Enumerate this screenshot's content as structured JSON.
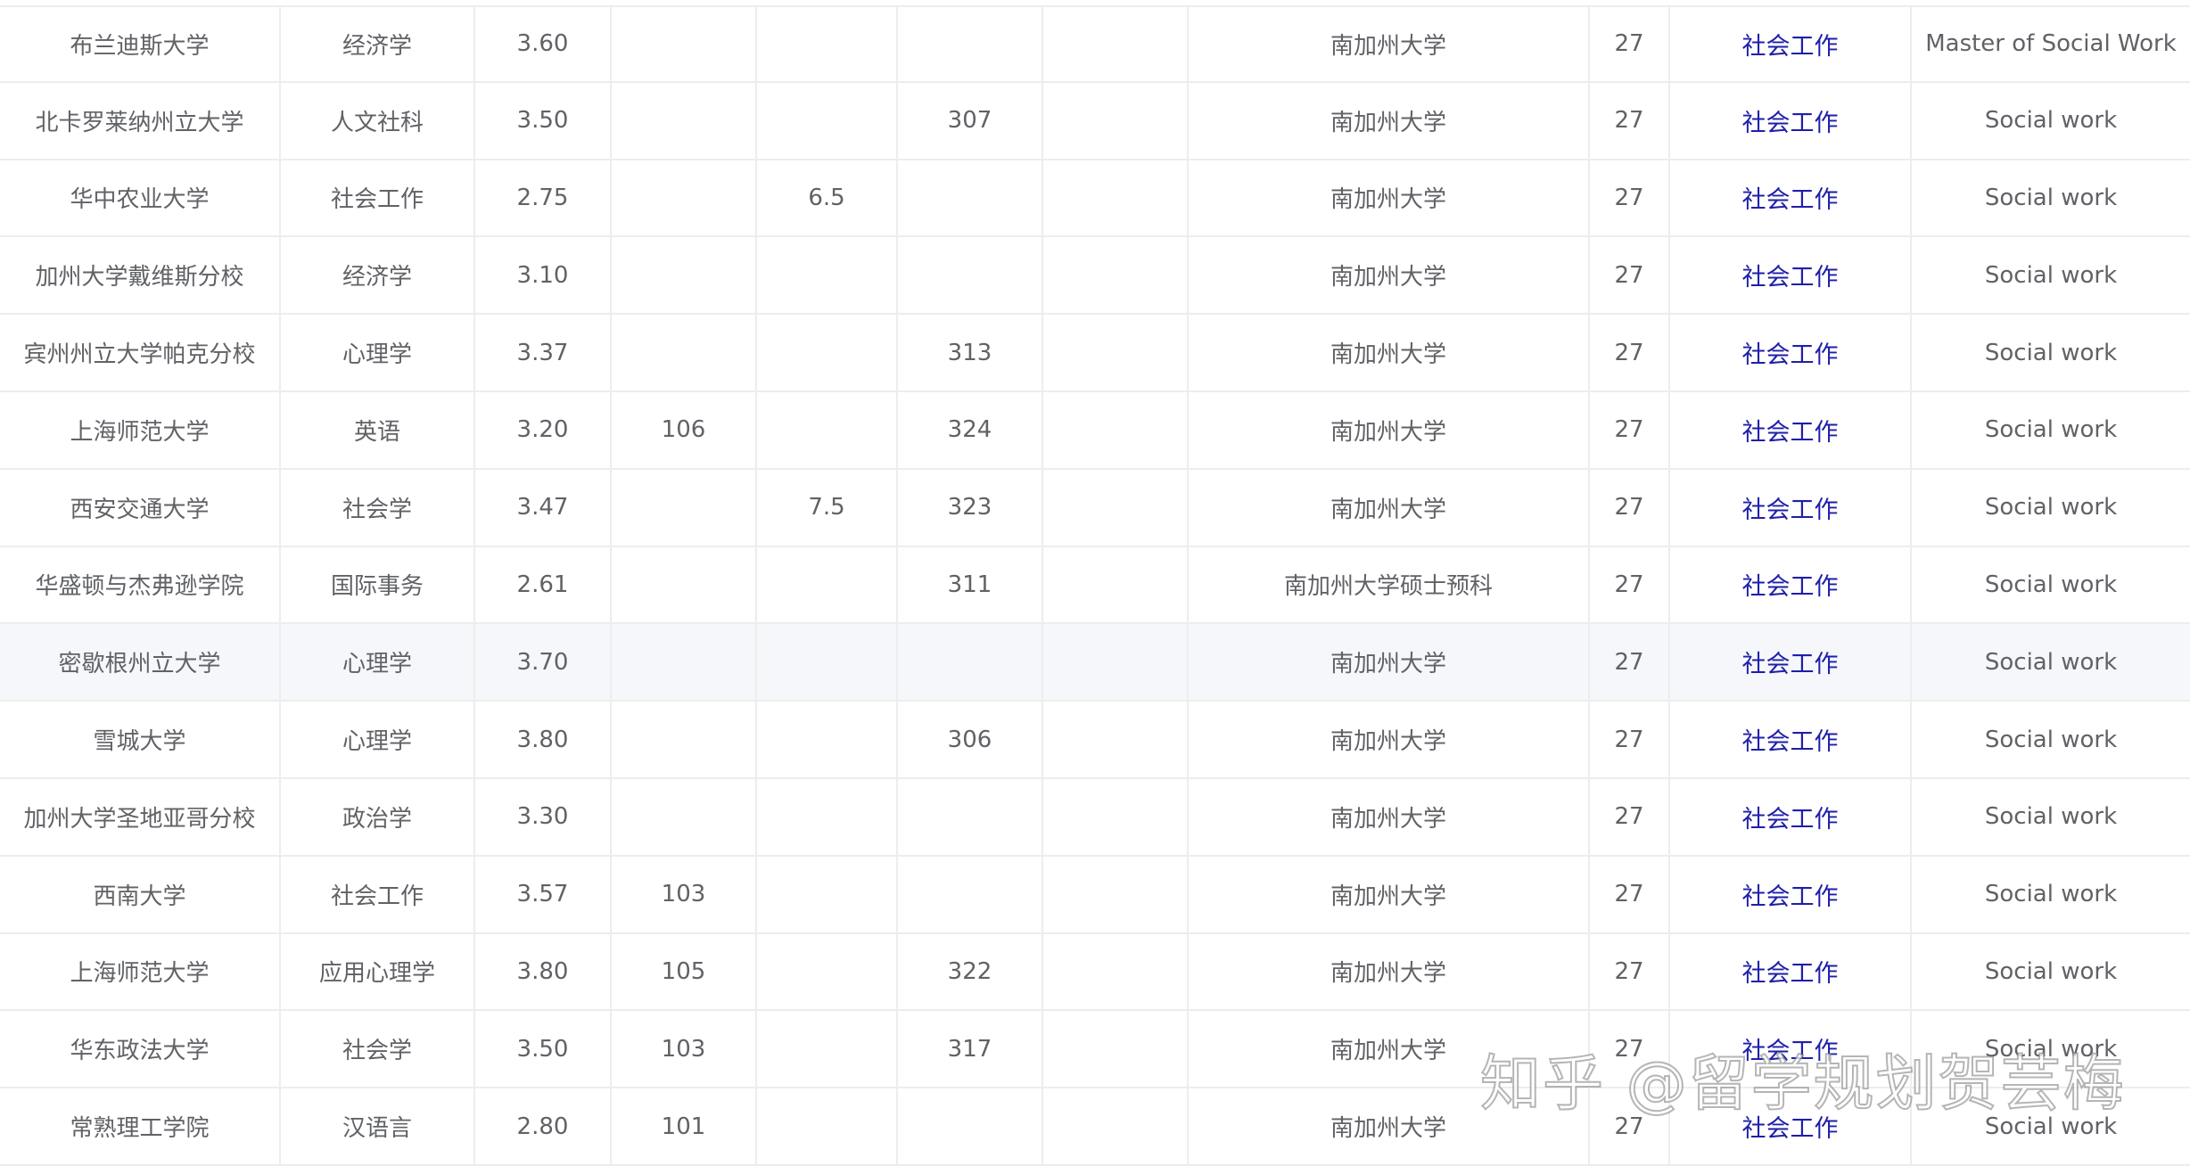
{
  "rows": [
    {
      "school": "布兰迪斯大学",
      "major": "经济学",
      "gpa": "3.60",
      "c3": "",
      "c4": "",
      "c5": "",
      "c6": "",
      "target": "南加州大学",
      "rank": "27",
      "program": "社会工作",
      "degree": "Master of Social Work"
    },
    {
      "school": "北卡罗莱纳州立大学",
      "major": "人文社科",
      "gpa": "3.50",
      "c3": "",
      "c4": "",
      "c5": "307",
      "c6": "",
      "target": "南加州大学",
      "rank": "27",
      "program": "社会工作",
      "degree": "Social work"
    },
    {
      "school": "华中农业大学",
      "major": "社会工作",
      "gpa": "2.75",
      "c3": "",
      "c4": "6.5",
      "c5": "",
      "c6": "",
      "target": "南加州大学",
      "rank": "27",
      "program": "社会工作",
      "degree": "Social work"
    },
    {
      "school": "加州大学戴维斯分校",
      "major": "经济学",
      "gpa": "3.10",
      "c3": "",
      "c4": "",
      "c5": "",
      "c6": "",
      "target": "南加州大学",
      "rank": "27",
      "program": "社会工作",
      "degree": "Social work"
    },
    {
      "school": "宾州州立大学帕克分校",
      "major": "心理学",
      "gpa": "3.37",
      "c3": "",
      "c4": "",
      "c5": "313",
      "c6": "",
      "target": "南加州大学",
      "rank": "27",
      "program": "社会工作",
      "degree": "Social work"
    },
    {
      "school": "上海师范大学",
      "major": "英语",
      "gpa": "3.20",
      "c3": "106",
      "c4": "",
      "c5": "324",
      "c6": "",
      "target": "南加州大学",
      "rank": "27",
      "program": "社会工作",
      "degree": "Social work"
    },
    {
      "school": "西安交通大学",
      "major": "社会学",
      "gpa": "3.47",
      "c3": "",
      "c4": "7.5",
      "c5": "323",
      "c6": "",
      "target": "南加州大学",
      "rank": "27",
      "program": "社会工作",
      "degree": "Social work"
    },
    {
      "school": "华盛顿与杰弗逊学院",
      "major": "国际事务",
      "gpa": "2.61",
      "c3": "",
      "c4": "",
      "c5": "311",
      "c6": "",
      "target": "南加州大学硕士预科",
      "rank": "27",
      "program": "社会工作",
      "degree": "Social work"
    },
    {
      "school": "密歇根州立大学",
      "major": "心理学",
      "gpa": "3.70",
      "c3": "",
      "c4": "",
      "c5": "",
      "c6": "",
      "target": "南加州大学",
      "rank": "27",
      "program": "社会工作",
      "degree": "Social work"
    },
    {
      "school": "雪城大学",
      "major": "心理学",
      "gpa": "3.80",
      "c3": "",
      "c4": "",
      "c5": "306",
      "c6": "",
      "target": "南加州大学",
      "rank": "27",
      "program": "社会工作",
      "degree": "Social work"
    },
    {
      "school": "加州大学圣地亚哥分校",
      "major": "政治学",
      "gpa": "3.30",
      "c3": "",
      "c4": "",
      "c5": "",
      "c6": "",
      "target": "南加州大学",
      "rank": "27",
      "program": "社会工作",
      "degree": "Social work"
    },
    {
      "school": "西南大学",
      "major": "社会工作",
      "gpa": "3.57",
      "c3": "103",
      "c4": "",
      "c5": "",
      "c6": "",
      "target": "南加州大学",
      "rank": "27",
      "program": "社会工作",
      "degree": "Social work"
    },
    {
      "school": "上海师范大学",
      "major": "应用心理学",
      "gpa": "3.80",
      "c3": "105",
      "c4": "",
      "c5": "322",
      "c6": "",
      "target": "南加州大学",
      "rank": "27",
      "program": "社会工作",
      "degree": "Social work"
    },
    {
      "school": "华东政法大学",
      "major": "社会学",
      "gpa": "3.50",
      "c3": "103",
      "c4": "",
      "c5": "317",
      "c6": "",
      "target": "南加州大学",
      "rank": "27",
      "program": "社会工作",
      "degree": "Social work"
    },
    {
      "school": "常熟理工学院",
      "major": "汉语言",
      "gpa": "2.80",
      "c3": "101",
      "c4": "",
      "c5": "",
      "c6": "",
      "target": "南加州大学",
      "rank": "27",
      "program": "社会工作",
      "degree": "Social work"
    }
  ],
  "watermark": "知乎 @留学规划贺芸梅",
  "colors": {
    "text": "#606266",
    "link": "#1f1faa",
    "border": "#ededed",
    "hover_row": "#f5f7fa"
  }
}
